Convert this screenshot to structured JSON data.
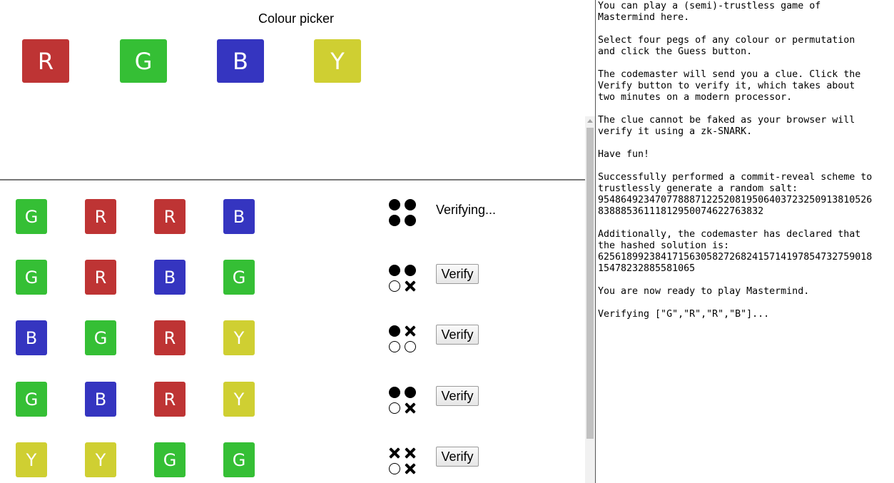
{
  "picker": {
    "title": "Colour picker",
    "buttons": [
      {
        "label": "R",
        "color": "#be3434"
      },
      {
        "label": "G",
        "color": "#35bf35"
      },
      {
        "label": "B",
        "color": "#3535c0"
      },
      {
        "label": "Y",
        "color": "#cfcf32"
      }
    ]
  },
  "guesses": [
    {
      "pegs": [
        "G",
        "R",
        "R",
        "B"
      ],
      "clue": [
        "black",
        "black",
        "black",
        "black"
      ],
      "status": "Verifying...",
      "action": null
    },
    {
      "pegs": [
        "G",
        "R",
        "B",
        "G"
      ],
      "clue": [
        "black",
        "black",
        "white",
        "cross"
      ],
      "status": null,
      "action": "Verify"
    },
    {
      "pegs": [
        "B",
        "G",
        "R",
        "Y"
      ],
      "clue": [
        "black",
        "cross",
        "white",
        "white"
      ],
      "status": null,
      "action": "Verify"
    },
    {
      "pegs": [
        "G",
        "B",
        "R",
        "Y"
      ],
      "clue": [
        "black",
        "black",
        "white",
        "cross"
      ],
      "status": null,
      "action": "Verify"
    },
    {
      "pegs": [
        "Y",
        "Y",
        "G",
        "G"
      ],
      "clue": [
        "cross",
        "cross",
        "white",
        "cross"
      ],
      "status": null,
      "action": "Verify"
    }
  ],
  "log": {
    "text": "You can play a (semi)-trustless game of\nMastermind here.\n\nSelect four pegs of any colour or permutation\nand click the Guess button.\n\nThe codemaster will send you a clue. Click the\nVerify button to verify it, which takes about\ntwo minutes on a modern processor.\n\nThe clue cannot be faked as your browser will\nverify it using a zk-SNARK.\n\nHave fun!\n\nSuccessfully performed a commit-reveal scheme to\ntrustlessly generate a random salt:\n9548649234707788871225208195064037232509138105 26\n8388853611181295007462276383 2\n\nAdditionally, the codemaster has declared that\nthe hashed solution is:\n625618992384171563058272682415714197854732759018\n15478232885581065\n\nYou are now ready to play Mastermind.\n\nVerifying [\"G\",\"R\",\"R\",\"B\"]..."
  }
}
